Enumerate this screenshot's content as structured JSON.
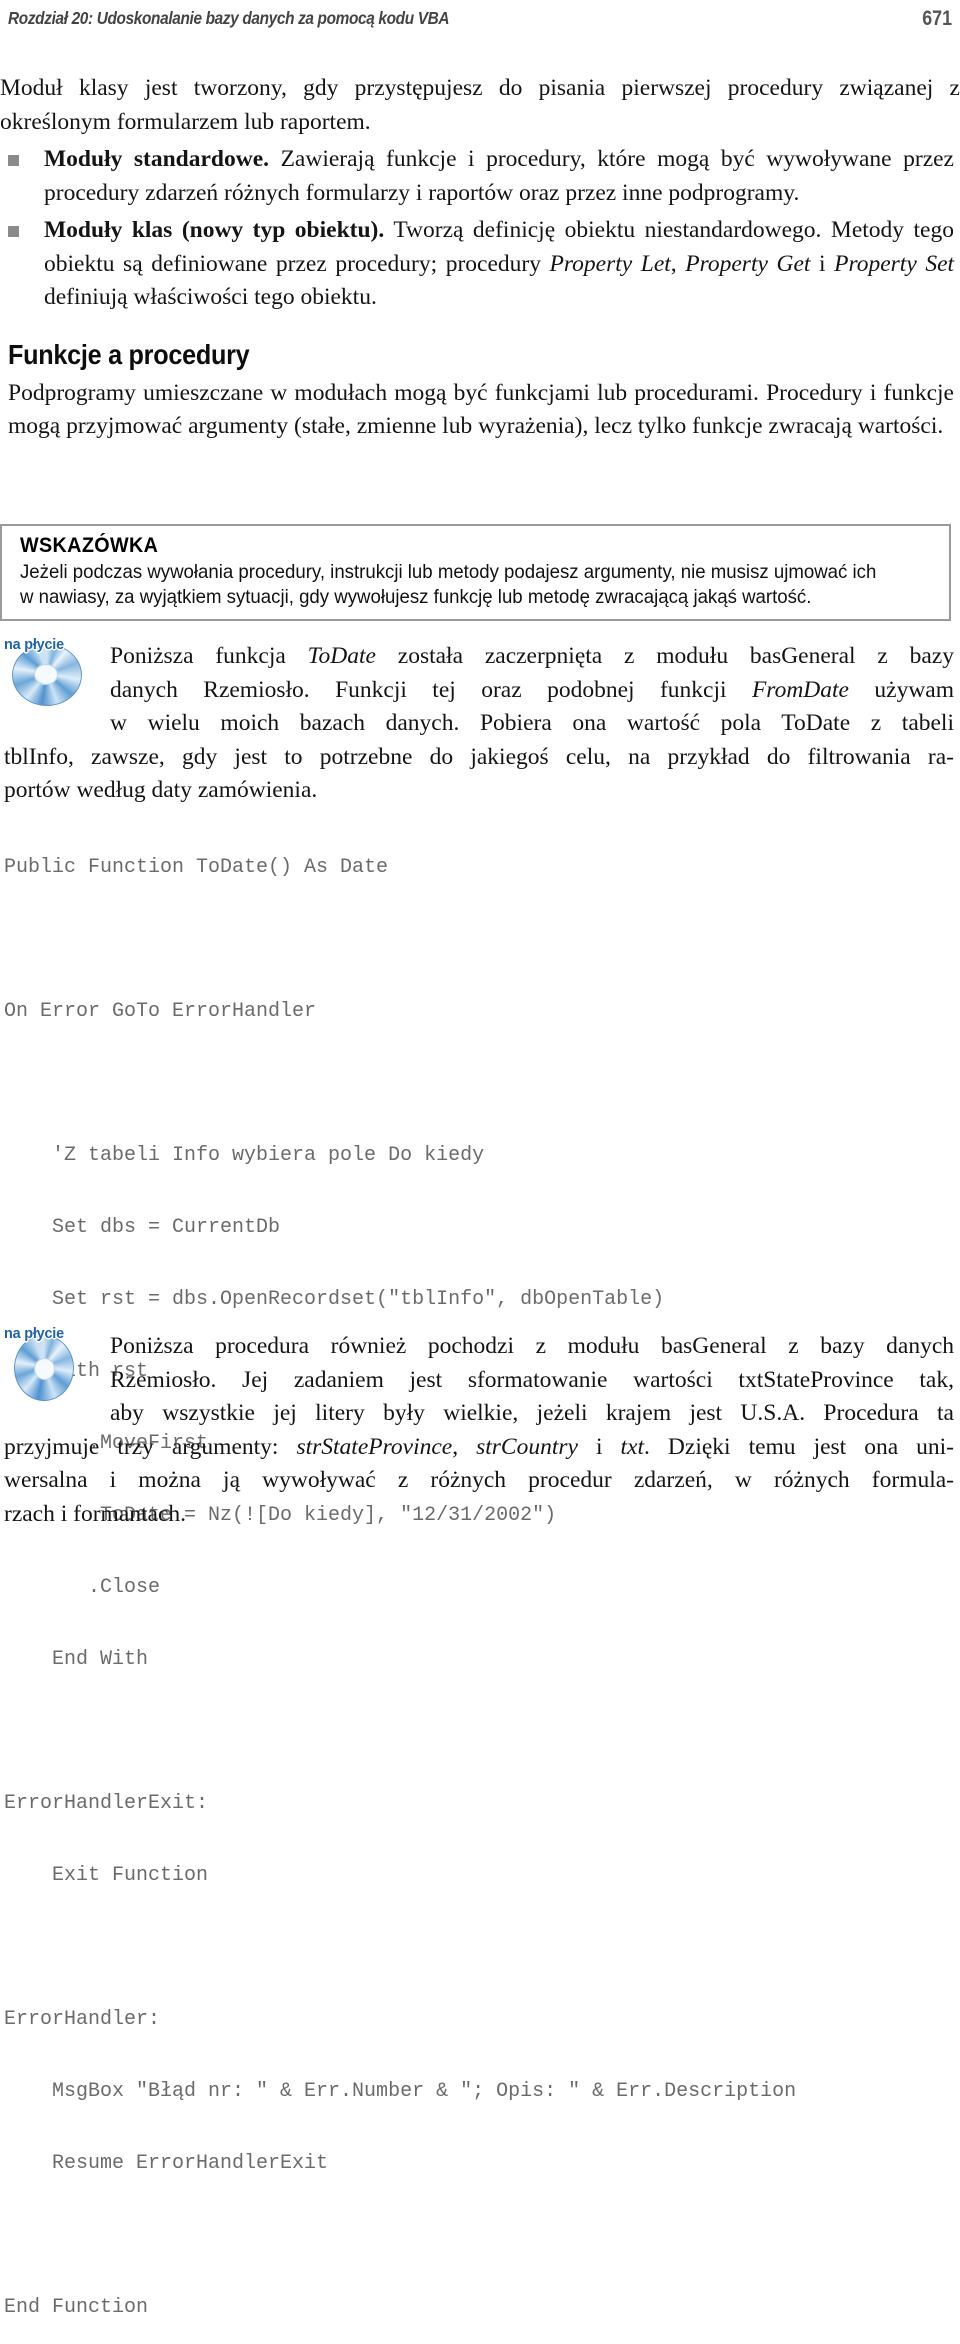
{
  "header": {
    "running_head": "Rozdział 20: Udoskonalanie bazy danych za pomocą kodu VBA",
    "page_number": "671"
  },
  "body": {
    "intro_paragraph": "Moduł klasy jest tworzony, gdy przystępujesz do pisania pierwszej procedury związanej z określonym formularzem lub raportem.",
    "bullets": [
      {
        "lead": "Moduły standardowe.",
        "text": " Zawierają funkcje i procedury, które mogą być wywoływane przez procedury zdarzeń różnych formularzy i raportów oraz przez inne podprogramy."
      },
      {
        "lead": "Moduły klas (nowy typ obiektu).",
        "text_1": " Tworzą definicję obiektu niestandardowego. Metody tego obiektu są definiowane przez procedury; procedury ",
        "italic_1": "Property Let",
        "text_2": ", ",
        "italic_2": "Property Get",
        "text_3": " i ",
        "italic_3": "Property Set",
        "text_4": " definiują właściwości tego obiektu."
      }
    ],
    "section_heading": "Funkcje a procedury",
    "section_paragraph": "Podprogramy umieszczane w modułach mogą być funkcjami lub procedurami. Procedury i funkcje mogą przyjmować argumenty (stałe, zmienne lub wyrażenia), lecz tylko funkcje zwracają wartości."
  },
  "tip": {
    "title": "WSKAZÓWKA",
    "line_1": "Jeżeli podczas wywołania procedury, instrukcji lub metody podajesz argumenty, nie musisz ujmować ich",
    "line_2": "w nawiasy, za wyjątkiem sytuacji, gdy wywołujesz funkcję lub metodę zwracającą jakąś wartość.",
    "border_color": "#9a9a9a"
  },
  "cd_note_1": {
    "icon_label": "na płycie",
    "lines": [
      "Poniższa funkcja ToDate została zaczerpnięta z modułu basGeneral z bazy",
      "danych Rzemiosło. Funkcji tej oraz podobnej funkcji FromDate używam",
      "w wielu moich bazach danych. Pobiera ona wartość pola ToDate z tabeli",
      "tblInfo, zawsze, gdy jest to potrzebne do jakiegoś celu, na przykład do filtrowania ra-",
      "portów według daty zamówienia."
    ],
    "italic_terms": [
      "ToDate",
      "FromDate"
    ]
  },
  "code_listing": {
    "language": "vba",
    "color": "#6b6b6b",
    "lines": [
      "Public Function ToDate() As Date",
      "",
      "On Error GoTo ErrorHandler",
      "",
      "    'Z tabeli Info wybiera pole Do kiedy",
      "    Set dbs = CurrentDb",
      "    Set rst = dbs.OpenRecordset(\"tblInfo\", dbOpenTable)",
      "    With rst",
      "       .MoveFirst",
      "        ToDate = Nz(![Do kiedy], \"12/31/2002\")",
      "       .Close",
      "    End With",
      "",
      "ErrorHandlerExit:",
      "    Exit Function",
      "",
      "ErrorHandler:",
      "    MsgBox \"Błąd nr: \" & Err.Number & \"; Opis: \" & Err.Description",
      "    Resume ErrorHandlerExit",
      "",
      "End Function"
    ]
  },
  "cd_note_2": {
    "icon_label": "na płycie",
    "lines": [
      "Poniższa procedura również pochodzi z modułu basGeneral z bazy danych",
      "Rzemiosło. Jej zadaniem jest sformatowanie wartości txtStateProvince tak,",
      "aby wszystkie jej litery były wielkie, jeżeli krajem jest U.S.A. Procedura ta",
      "przyjmuje trzy argumenty: strStateProvince, strCountry i txt. Dzięki temu jest ona uni-",
      "wersalna i można ją wywoływać z różnych procedur zdarzeń, w różnych formula-",
      "rzach i formantach."
    ],
    "italic_terms": [
      "strStateProvince",
      "strCountry",
      "txt"
    ]
  }
}
